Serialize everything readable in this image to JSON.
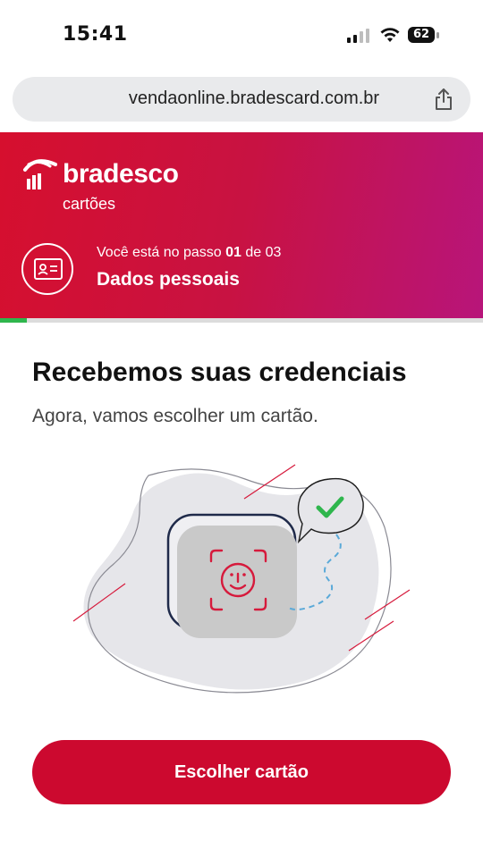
{
  "status_bar": {
    "time": "15:41",
    "battery": "62"
  },
  "browser": {
    "url": "vendaonline.bradescard.com.br"
  },
  "header": {
    "brand": "bradesco",
    "brand_sub": "cartões",
    "step_prefix": "Você está no passo ",
    "step_current": "01",
    "step_middle": " de ",
    "step_total": "03",
    "step_title": "Dados pessoais"
  },
  "progress": {
    "fraction": 0.055
  },
  "main": {
    "headline": "Recebemos suas credenciais",
    "subline": "Agora, vamos escolher um cartão."
  },
  "cta": {
    "label": "Escolher cartão"
  },
  "colors": {
    "brand_red": "#cc092f",
    "progress_green": "#2fb64d",
    "check_green": "#2fb64d"
  }
}
